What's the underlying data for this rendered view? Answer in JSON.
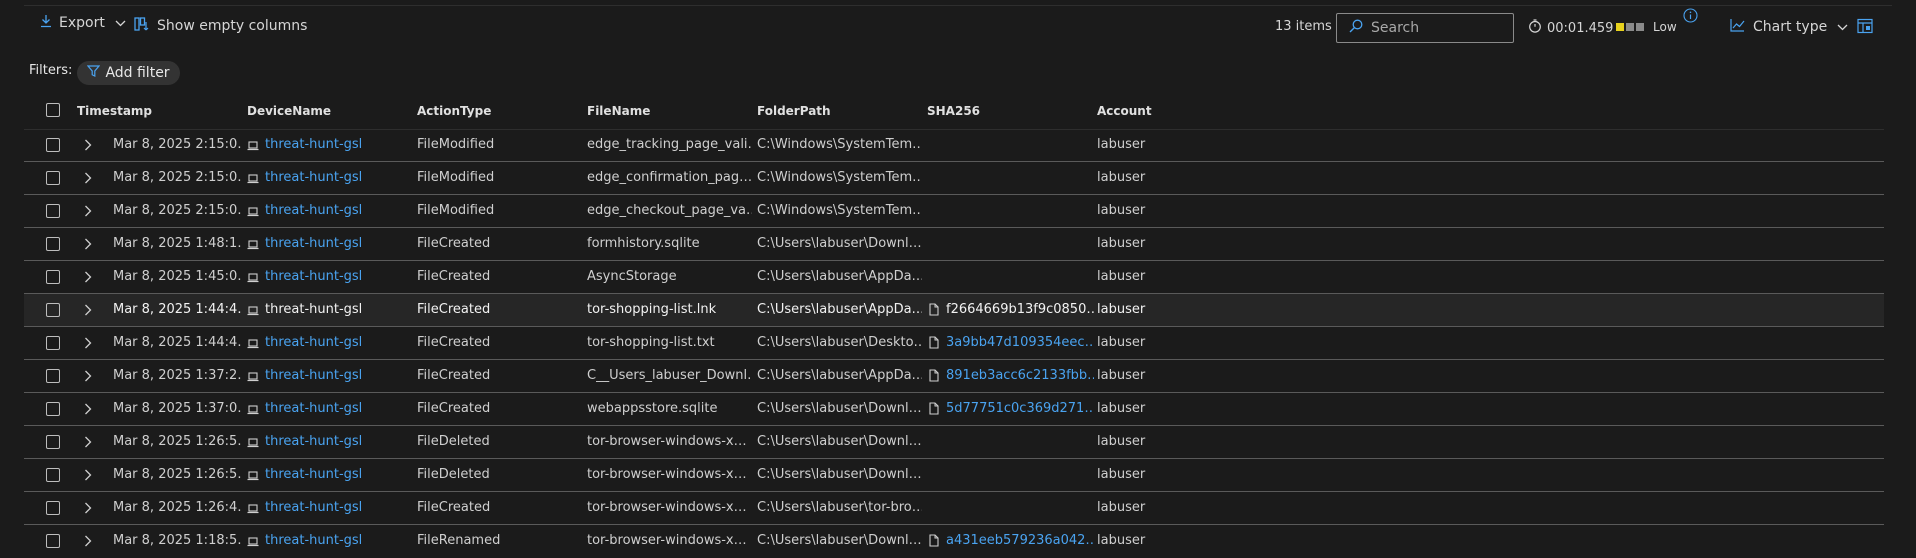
{
  "toolbar": {
    "export_label": "Export",
    "show_empty_label": "Show empty columns",
    "items_count": "13 items",
    "search_placeholder": "Search",
    "timer": "00:01.459",
    "severity_label": "Low",
    "chart_type_label": "Chart type",
    "severity_colors": [
      "#e8d21d",
      "#8a8a8a",
      "#8a8a8a"
    ]
  },
  "filters": {
    "label": "Filters:",
    "add_filter_label": "Add filter"
  },
  "columns": [
    "Timestamp",
    "DeviceName",
    "ActionType",
    "FileName",
    "FolderPath",
    "SHA256",
    "Account"
  ],
  "rows": [
    {
      "timestamp": "Mar 8, 2025 2:15:0…",
      "device": "threat-hunt-gsl",
      "action": "FileModified",
      "filename": "edge_tracking_page_vali…",
      "folder": "C:\\Windows\\SystemTem…",
      "sha": "",
      "account": "labuser"
    },
    {
      "timestamp": "Mar 8, 2025 2:15:0…",
      "device": "threat-hunt-gsl",
      "action": "FileModified",
      "filename": "edge_confirmation_pag…",
      "folder": "C:\\Windows\\SystemTem…",
      "sha": "",
      "account": "labuser"
    },
    {
      "timestamp": "Mar 8, 2025 2:15:0…",
      "device": "threat-hunt-gsl",
      "action": "FileModified",
      "filename": "edge_checkout_page_va…",
      "folder": "C:\\Windows\\SystemTem…",
      "sha": "",
      "account": "labuser"
    },
    {
      "timestamp": "Mar 8, 2025 1:48:1…",
      "device": "threat-hunt-gsl",
      "action": "FileCreated",
      "filename": "formhistory.sqlite",
      "folder": "C:\\Users\\labuser\\Downl…",
      "sha": "",
      "account": "labuser"
    },
    {
      "timestamp": "Mar 8, 2025 1:45:0…",
      "device": "threat-hunt-gsl",
      "action": "FileCreated",
      "filename": "AsyncStorage",
      "folder": "C:\\Users\\labuser\\AppDa…",
      "sha": "",
      "account": "labuser"
    },
    {
      "timestamp": "Mar 8, 2025 1:44:4…",
      "device": "threat-hunt-gsl",
      "action": "FileCreated",
      "filename": "tor-shopping-list.lnk",
      "folder": "C:\\Users\\labuser\\AppDa…",
      "sha": "f2664669b13f9c0850…",
      "account": "labuser"
    },
    {
      "timestamp": "Mar 8, 2025 1:44:4…",
      "device": "threat-hunt-gsl",
      "action": "FileCreated",
      "filename": "tor-shopping-list.txt",
      "folder": "C:\\Users\\labuser\\Deskto…",
      "sha": "3a9bb47d109354eec…",
      "account": "labuser"
    },
    {
      "timestamp": "Mar 8, 2025 1:37:2…",
      "device": "threat-hunt-gsl",
      "action": "FileCreated",
      "filename": "C__Users_labuser_Downl…",
      "folder": "C:\\Users\\labuser\\AppDa…",
      "sha": "891eb3acc6c2133fbb…",
      "account": "labuser"
    },
    {
      "timestamp": "Mar 8, 2025 1:37:0…",
      "device": "threat-hunt-gsl",
      "action": "FileCreated",
      "filename": "webappsstore.sqlite",
      "folder": "C:\\Users\\labuser\\Downl…",
      "sha": "5d77751c0c369d271…",
      "account": "labuser"
    },
    {
      "timestamp": "Mar 8, 2025 1:26:5…",
      "device": "threat-hunt-gsl",
      "action": "FileDeleted",
      "filename": "tor-browser-windows-x…",
      "folder": "C:\\Users\\labuser\\Downl…",
      "sha": "",
      "account": "labuser"
    },
    {
      "timestamp": "Mar 8, 2025 1:26:5…",
      "device": "threat-hunt-gsl",
      "action": "FileDeleted",
      "filename": "tor-browser-windows-x…",
      "folder": "C:\\Users\\labuser\\Downl…",
      "sha": "",
      "account": "labuser"
    },
    {
      "timestamp": "Mar 8, 2025 1:26:4…",
      "device": "threat-hunt-gsl",
      "action": "FileCreated",
      "filename": "tor-browser-windows-x…",
      "folder": "C:\\Users\\labuser\\tor-bro…",
      "sha": "",
      "account": "labuser"
    },
    {
      "timestamp": "Mar 8, 2025 1:18:5…",
      "device": "threat-hunt-gsl",
      "action": "FileRenamed",
      "filename": "tor-browser-windows-x…",
      "folder": "C:\\Users\\labuser\\Downl…",
      "sha": "a431eeb579236a042…",
      "account": "labuser"
    }
  ],
  "selected_row_index": 5
}
